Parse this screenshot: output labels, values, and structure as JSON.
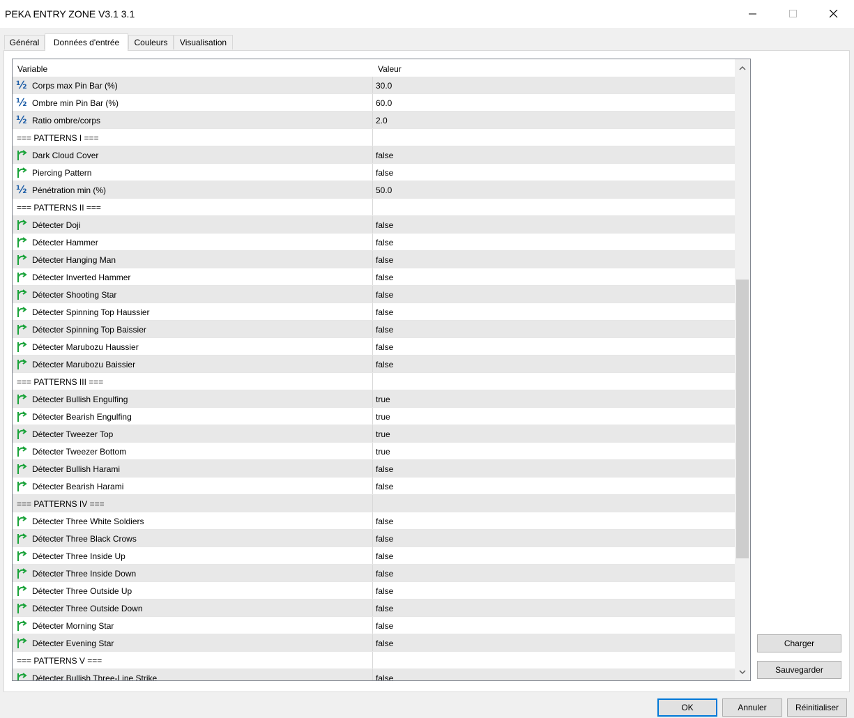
{
  "window": {
    "title": "PEKA ENTRY ZONE V3.1 3.1",
    "minimize_icon": "minimize-icon",
    "maximize_icon": "maximize-icon",
    "close_icon": "close-icon"
  },
  "tabs": [
    {
      "label": "Général",
      "active": false
    },
    {
      "label": "Données d'entrée",
      "active": true
    },
    {
      "label": "Couleurs",
      "active": false
    },
    {
      "label": "Visualisation",
      "active": false
    }
  ],
  "grid": {
    "col_variable": "Variable",
    "col_value": "Valeur",
    "rows": [
      {
        "type": "param",
        "icon": "fraction-icon",
        "label": "Corps max Pin Bar (%)",
        "value": "30.0"
      },
      {
        "type": "param",
        "icon": "fraction-icon",
        "label": "Ombre min Pin Bar (%)",
        "value": "60.0"
      },
      {
        "type": "param",
        "icon": "fraction-icon",
        "label": "Ratio ombre/corps",
        "value": "2.0"
      },
      {
        "type": "section",
        "label": "=== PATTERNS I ===",
        "value": ""
      },
      {
        "type": "param",
        "icon": "bool-icon",
        "label": "Dark Cloud Cover",
        "value": "false"
      },
      {
        "type": "param",
        "icon": "bool-icon",
        "label": "Piercing Pattern",
        "value": "false"
      },
      {
        "type": "param",
        "icon": "fraction-icon",
        "label": "Pénétration min (%)",
        "value": "50.0"
      },
      {
        "type": "section",
        "label": "=== PATTERNS II ===",
        "value": ""
      },
      {
        "type": "param",
        "icon": "bool-icon",
        "label": "Détecter Doji",
        "value": "false"
      },
      {
        "type": "param",
        "icon": "bool-icon",
        "label": "Détecter Hammer",
        "value": "false"
      },
      {
        "type": "param",
        "icon": "bool-icon",
        "label": "Détecter Hanging Man",
        "value": "false"
      },
      {
        "type": "param",
        "icon": "bool-icon",
        "label": "Détecter Inverted Hammer",
        "value": "false"
      },
      {
        "type": "param",
        "icon": "bool-icon",
        "label": "Détecter Shooting Star",
        "value": "false"
      },
      {
        "type": "param",
        "icon": "bool-icon",
        "label": "Détecter Spinning Top Haussier",
        "value": "false"
      },
      {
        "type": "param",
        "icon": "bool-icon",
        "label": "Détecter Spinning Top Baissier",
        "value": "false"
      },
      {
        "type": "param",
        "icon": "bool-icon",
        "label": "Détecter Marubozu Haussier",
        "value": "false"
      },
      {
        "type": "param",
        "icon": "bool-icon",
        "label": "Détecter Marubozu Baissier",
        "value": "false"
      },
      {
        "type": "section",
        "label": "=== PATTERNS III ===",
        "value": ""
      },
      {
        "type": "param",
        "icon": "bool-icon",
        "label": "Détecter Bullish Engulfing",
        "value": "true"
      },
      {
        "type": "param",
        "icon": "bool-icon",
        "label": "Détecter Bearish Engulfing",
        "value": "true"
      },
      {
        "type": "param",
        "icon": "bool-icon",
        "label": "Détecter Tweezer Top",
        "value": "true"
      },
      {
        "type": "param",
        "icon": "bool-icon",
        "label": "Détecter Tweezer Bottom",
        "value": "true"
      },
      {
        "type": "param",
        "icon": "bool-icon",
        "label": "Détecter Bullish Harami",
        "value": "false"
      },
      {
        "type": "param",
        "icon": "bool-icon",
        "label": "Détecter Bearish Harami",
        "value": "false"
      },
      {
        "type": "section",
        "label": "=== PATTERNS IV ===",
        "value": ""
      },
      {
        "type": "param",
        "icon": "bool-icon",
        "label": "Détecter Three White Soldiers",
        "value": "false"
      },
      {
        "type": "param",
        "icon": "bool-icon",
        "label": "Détecter Three Black Crows",
        "value": "false"
      },
      {
        "type": "param",
        "icon": "bool-icon",
        "label": "Détecter Three Inside Up",
        "value": "false"
      },
      {
        "type": "param",
        "icon": "bool-icon",
        "label": "Détecter Three Inside Down",
        "value": "false"
      },
      {
        "type": "param",
        "icon": "bool-icon",
        "label": "Détecter Three Outside Up",
        "value": "false"
      },
      {
        "type": "param",
        "icon": "bool-icon",
        "label": "Détecter Three Outside Down",
        "value": "false"
      },
      {
        "type": "param",
        "icon": "bool-icon",
        "label": "Détecter Morning Star",
        "value": "false"
      },
      {
        "type": "param",
        "icon": "bool-icon",
        "label": "Détecter Evening Star",
        "value": "false"
      },
      {
        "type": "section",
        "label": "=== PATTERNS V ===",
        "value": ""
      },
      {
        "type": "param",
        "icon": "bool-icon",
        "label": "Détecter Bullish Three-Line Strike",
        "value": "false"
      }
    ]
  },
  "side_buttons": {
    "load": "Charger",
    "save": "Sauvegarder"
  },
  "footer_buttons": {
    "ok": "OK",
    "cancel": "Annuler",
    "reset": "Réinitialiser"
  },
  "colors": {
    "bool_icon": "#1aa33a",
    "fraction_icon": "#1f5fa8",
    "default_button_border": "#0078d7"
  }
}
